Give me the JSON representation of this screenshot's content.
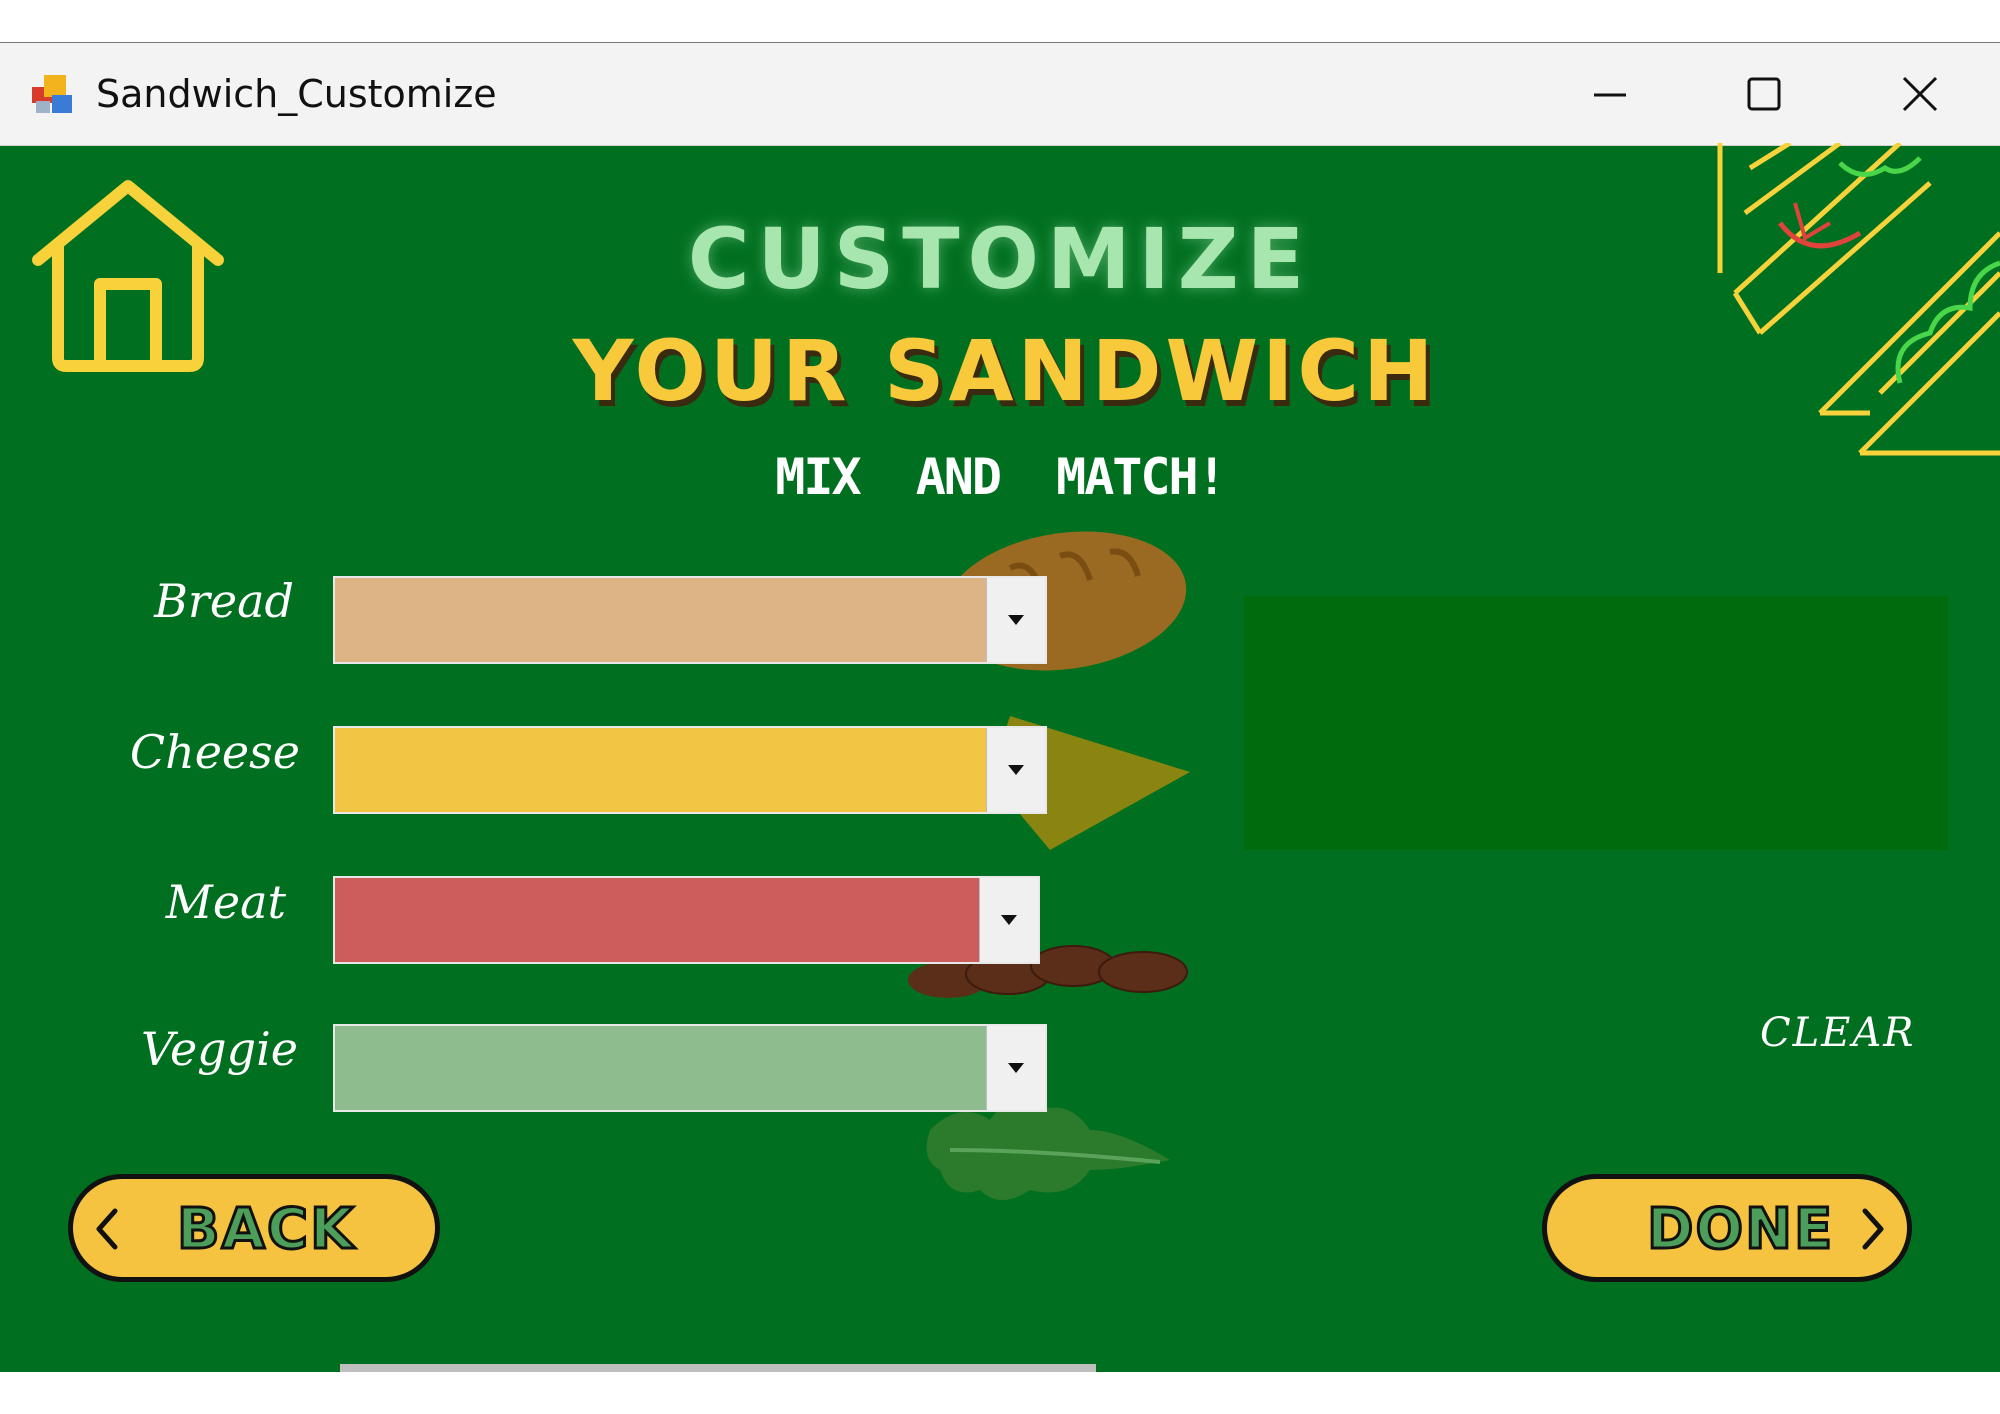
{
  "window": {
    "title": "Sandwich_Customize",
    "icons": [
      "app-icon",
      "minimize-icon",
      "maximize-icon",
      "close-icon"
    ]
  },
  "header": {
    "line1": "CUSTOMIZE",
    "line2": "YOUR SANDWICH",
    "line3": "MIX AND MATCH!"
  },
  "form": {
    "bread_label": "Bread",
    "cheese_label": "Cheese",
    "meat_label": "Meat",
    "veggie_label": "Veggie",
    "bread_value": "",
    "cheese_value": "",
    "meat_value": "",
    "veggie_value": ""
  },
  "colors": {
    "background": "#007020",
    "bread": "#dcb486",
    "cheese": "#f2c544",
    "meat": "#cd5c5c",
    "veggie": "#8fbc8f",
    "accent": "#f5c33f",
    "preview": "#006b0c"
  },
  "actions": {
    "clear_label": "CLEAR",
    "back_label": "BACK",
    "done_label": "DONE"
  }
}
